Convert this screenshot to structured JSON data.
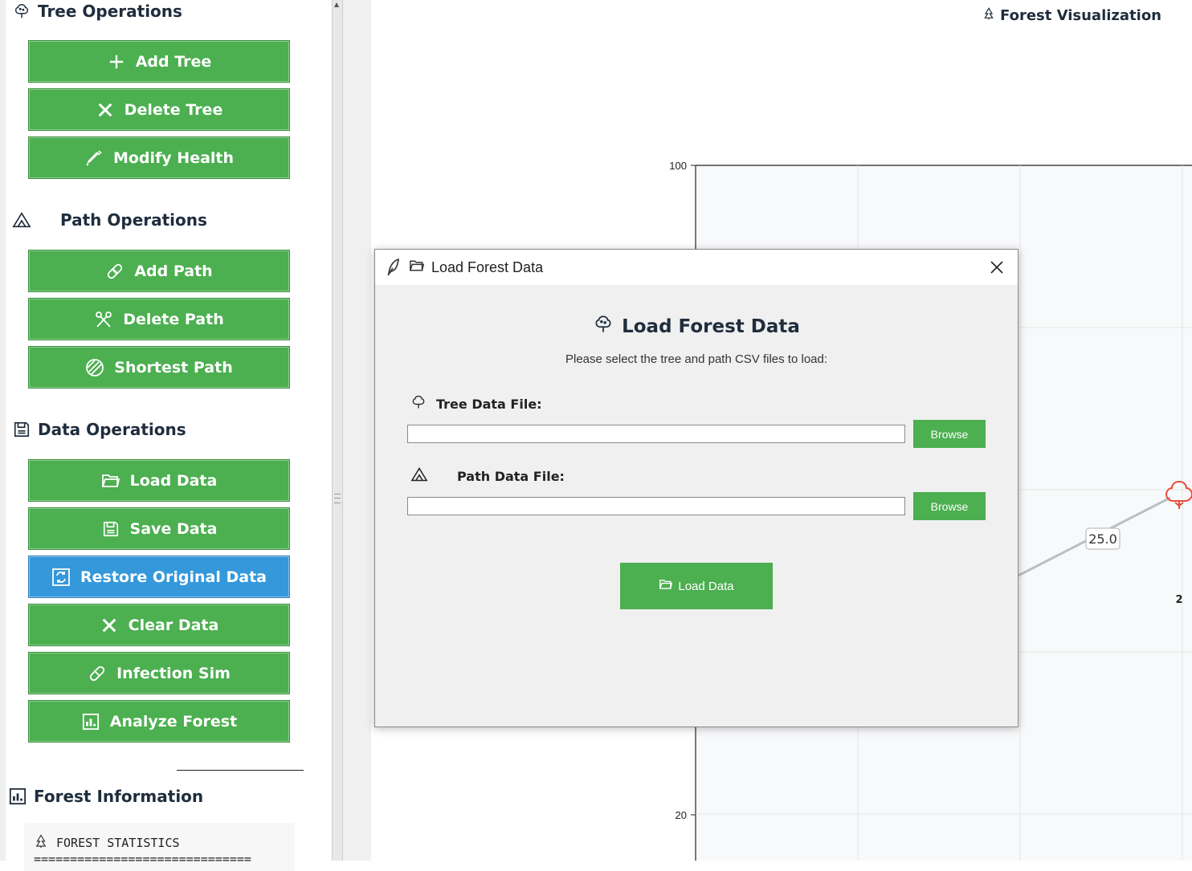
{
  "sidebar": {
    "tree_ops_title": "Tree Operations",
    "path_ops_title": "Path Operations",
    "data_ops_title": "Data Operations",
    "forest_info_title": "Forest Information",
    "buttons": {
      "add_tree": "Add Tree",
      "delete_tree": "Delete Tree",
      "modify_health": "Modify Health",
      "add_path": "Add Path",
      "delete_path": "Delete Path",
      "shortest_path": "Shortest Path",
      "load_data": "Load Data",
      "save_data": "Save Data",
      "restore_data": "Restore Original Data",
      "clear_data": "Clear Data",
      "infection_sim": "Infection Sim",
      "analyze_forest": "Analyze Forest"
    },
    "info": {
      "heading": "FOREST STATISTICS",
      "rule": "=============================="
    }
  },
  "plot": {
    "title": "Forest Visualization",
    "y_tick_top": "100",
    "y_tick_bottom": "20",
    "edge_weight_label": "25.0",
    "node_label": "2"
  },
  "dialog": {
    "window_title": "Load Forest Data",
    "heading": "Load Forest Data",
    "subtitle": "Please select the tree and path CSV files to load:",
    "tree_label": "Tree Data File:",
    "path_label": "Path Data File:",
    "tree_value": "",
    "path_value": "",
    "browse_label": "Browse",
    "load_button": "Load Data"
  },
  "colors": {
    "button_green": "#4caf50",
    "button_blue": "#3498db",
    "infected_tree": "#e74c3c",
    "edge": "#b8c0c4"
  }
}
